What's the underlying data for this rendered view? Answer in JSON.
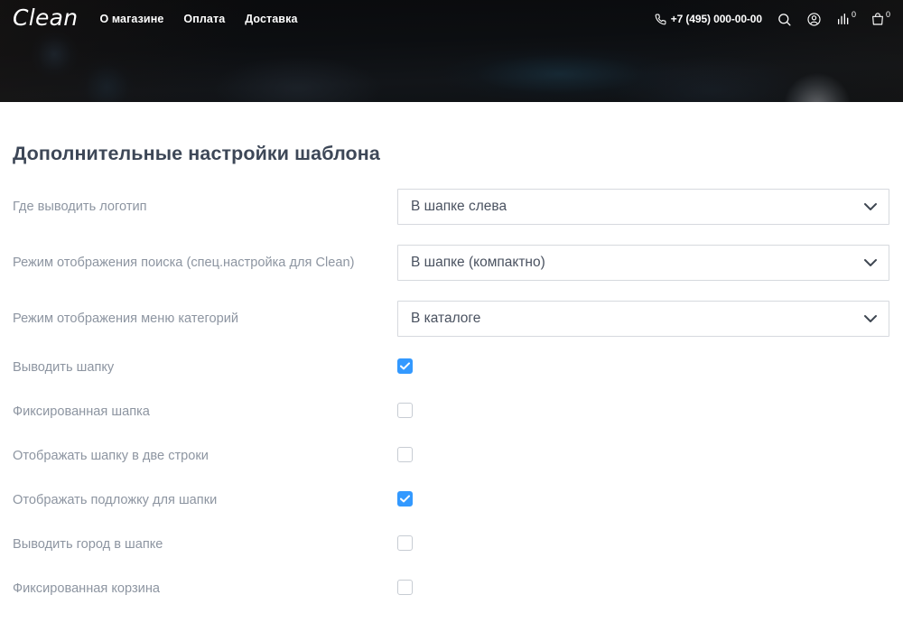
{
  "header": {
    "logo_text": "Clean",
    "nav": [
      {
        "label": "О магазине"
      },
      {
        "label": "Оплата"
      },
      {
        "label": "Доставка"
      }
    ],
    "phone": "+7 (495) 000-00-00",
    "phone_icon": "phone-icon",
    "icons": [
      {
        "name": "search-icon"
      },
      {
        "name": "account-icon"
      },
      {
        "name": "compare-icon",
        "badge": "0"
      },
      {
        "name": "cart-icon",
        "badge": "0"
      }
    ]
  },
  "main": {
    "title": "Дополнительные настройки шаблона",
    "select_rows": [
      {
        "label": "Где выводить логотип",
        "value": "В шапке слева",
        "options": [
          "В шапке слева"
        ]
      },
      {
        "label": "Режим отображения поиска (спец.настройка для Clean)",
        "value": "В шапке (компактно)",
        "options": [
          "В шапке (компактно)"
        ]
      },
      {
        "label": "Режим отображения меню категорий",
        "value": "В каталоге",
        "options": [
          "В каталоге"
        ]
      }
    ],
    "checkbox_rows": [
      {
        "label": "Выводить шапку",
        "checked": true
      },
      {
        "label": "Фиксированная шапка",
        "checked": false
      },
      {
        "label": "Отображать шапку в две строки",
        "checked": false
      },
      {
        "label": "Отображать подложку для шапки",
        "checked": true
      },
      {
        "label": "Выводить город в шапке",
        "checked": false
      },
      {
        "label": "Фиксированная корзина",
        "checked": false
      }
    ]
  },
  "colors": {
    "accent": "#3399ff",
    "title": "#3d4757",
    "label": "#8d95a1",
    "value": "#4a5260",
    "border": "#d6d9de",
    "hero_bg": "#0b0d10"
  }
}
